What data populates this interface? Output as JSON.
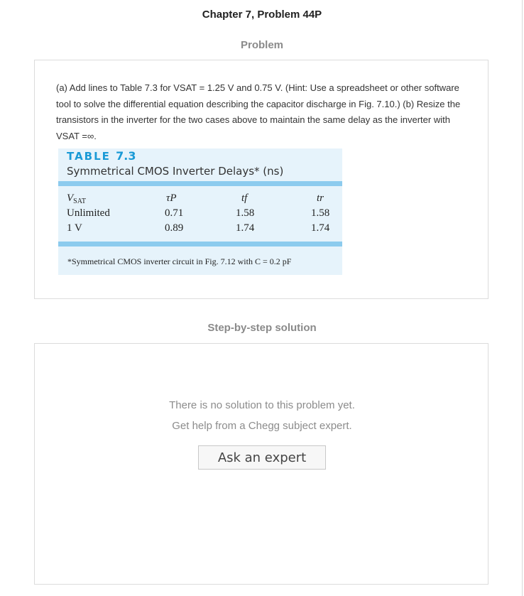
{
  "header": {
    "title": "Chapter 7, Problem 44P"
  },
  "problem": {
    "section_title": "Problem",
    "text": "(a) Add lines to Table 7.3 for VSAT = 1.25 V and 0.75 V. (Hint: Use a spreadsheet or other software tool to solve the differential equation describing the capacitor discharge in Fig. 7.10.) (b) Resize the transistors in the inverter for the two cases above to maintain the same delay as the inverter with VSAT =∞.",
    "table": {
      "label_word": "TABLE",
      "label_number": "7.3",
      "caption": "Symmetrical CMOS Inverter Delays* (ns)",
      "columns": [
        "V",
        "SAT",
        "τP",
        "tf",
        "tr"
      ],
      "rows": [
        [
          "Unlimited",
          "0.71",
          "1.58",
          "1.58"
        ],
        [
          "1 V",
          "0.89",
          "1.74",
          "1.74"
        ]
      ],
      "footnote": "*Symmetrical CMOS inverter circuit in Fig. 7.12 with C = 0.2 pF"
    }
  },
  "solution": {
    "section_title": "Step-by-step solution",
    "message_line1": "There is no solution to this problem yet.",
    "message_line2": "Get help from a Chegg subject expert.",
    "ask_button": "Ask an expert"
  },
  "colors": {
    "accent": "#1a9ad6",
    "table_bg": "#e6f3fb",
    "table_band": "#8ccbee"
  }
}
